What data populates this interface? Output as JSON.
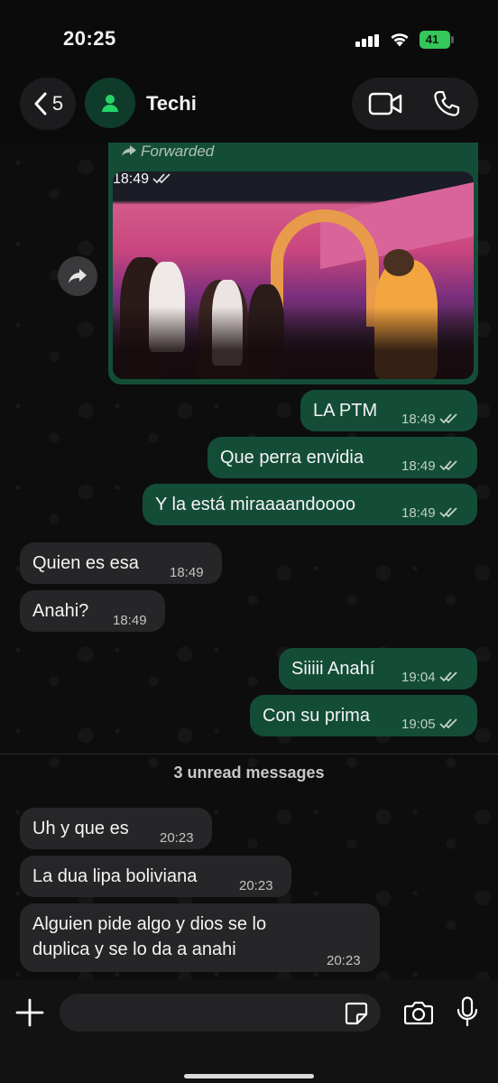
{
  "status_bar": {
    "time": "20:25",
    "battery": "41"
  },
  "header": {
    "back_count": "5",
    "contact_name": "Techi"
  },
  "media_message": {
    "forwarded_label": "Forwarded",
    "time": "18:49"
  },
  "outgoing_1": [
    {
      "text": "LA PTM",
      "time": "18:49"
    },
    {
      "text": "Que perra envidia",
      "time": "18:49"
    },
    {
      "text": "Y la está miraaaandoooo",
      "time": "18:49"
    }
  ],
  "incoming_1": [
    {
      "text": "Quien es esa",
      "time": "18:49"
    },
    {
      "text": "Anahi?",
      "time": "18:49"
    }
  ],
  "outgoing_2": [
    {
      "text": "Siiiii Anahí",
      "time": "19:04"
    },
    {
      "text": "Con su prima",
      "time": "19:05"
    }
  ],
  "unread_label": "3 unread messages",
  "incoming_2": [
    {
      "text": "Uh y que es",
      "time": "20:23"
    },
    {
      "text": "La dua lipa boliviana",
      "time": "20:23"
    },
    {
      "text_line1": "Alguien pide algo y dios se lo",
      "text_line2": "duplica y se lo da a anahi",
      "time": "20:23"
    }
  ],
  "colors": {
    "outgoing_bubble": "#144d37",
    "incoming_bubble": "#262628",
    "accent": "#25d366"
  }
}
